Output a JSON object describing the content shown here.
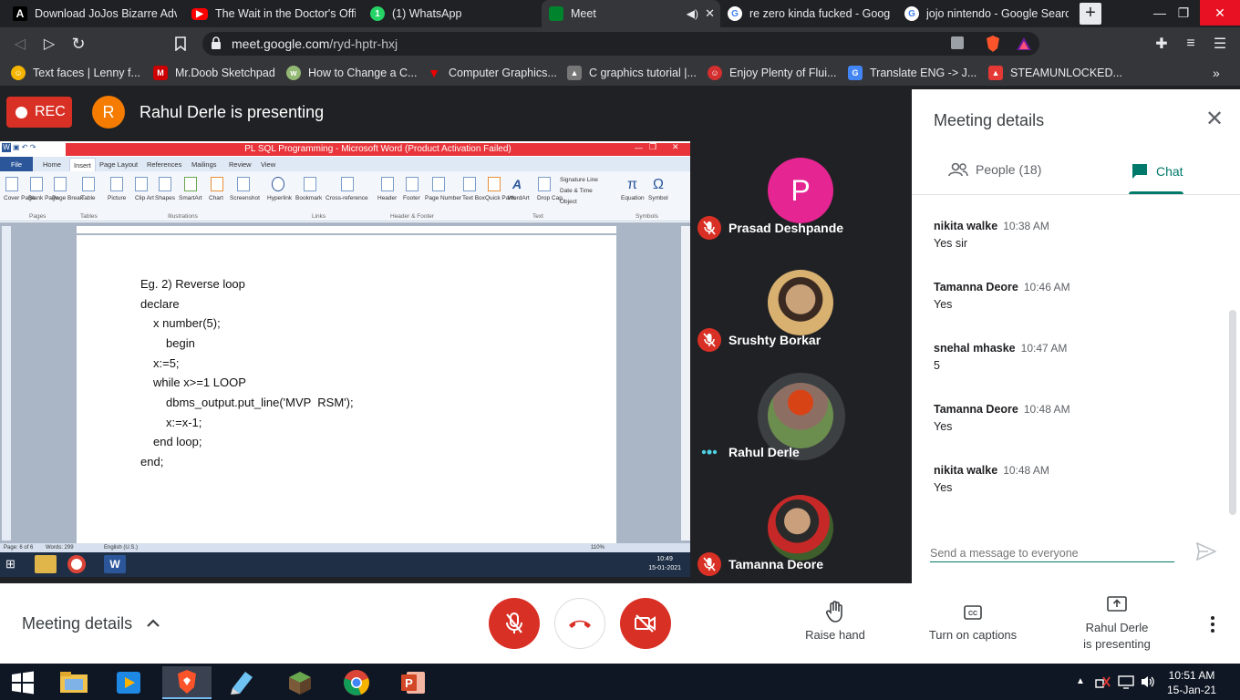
{
  "tabs": [
    {
      "label": "Download JoJos Bizarre Adven",
      "icon": "a-icon"
    },
    {
      "label": "The Wait in the Doctor's Office",
      "icon": "youtube-icon"
    },
    {
      "label": "(1) WhatsApp",
      "icon": "whatsapp-icon"
    },
    {
      "label": "Meet",
      "icon": "meet-icon"
    },
    {
      "label": "re zero kinda fucked - Google",
      "icon": "google-icon"
    },
    {
      "label": "jojo nintendo - Google Search",
      "icon": "google-icon"
    }
  ],
  "url": {
    "host": "meet.google.com",
    "path": "/ryd-hptr-hxj"
  },
  "bookmarks": [
    {
      "label": "Text faces | Lenny f..."
    },
    {
      "label": "Mr.Doob Sketchpad"
    },
    {
      "label": "How to Change a C..."
    },
    {
      "label": "Computer Graphics..."
    },
    {
      "label": "C graphics tutorial |..."
    },
    {
      "label": "Enjoy Plenty of Flui..."
    },
    {
      "label": "Translate ENG -> J..."
    },
    {
      "label": "STEAMUNLOCKED..."
    }
  ],
  "meet": {
    "rec_label": "REC",
    "presenter_initial": "R",
    "presenting_label": "Rahul Derle is presenting"
  },
  "shared_screen": {
    "word_title": "PL SQL Programming - Microsoft Word (Product Activation Failed)",
    "word_tabs": [
      "File",
      "Home",
      "Insert",
      "Page Layout",
      "References",
      "Mailings",
      "Review",
      "View"
    ],
    "ribbon_items": [
      "Cover Page",
      "Blank Page",
      "Page Break",
      "Table",
      "Picture",
      "Clip Art",
      "Shapes",
      "SmartArt",
      "Chart",
      "Screenshot",
      "Hyperlink",
      "Bookmark",
      "Cross-reference",
      "Header",
      "Footer",
      "Page Number",
      "Text Box",
      "Quick Parts",
      "WordArt",
      "Drop Cap",
      "Equation",
      "Symbol"
    ],
    "ribbon_side": [
      "Signature Line",
      "Date & Time",
      "Object"
    ],
    "ribbon_groups": [
      "Pages",
      "Tables",
      "Illustrations",
      "Links",
      "Header & Footer",
      "Text",
      "Symbols"
    ],
    "code_lines": [
      "Eg. 2) Reverse loop",
      "declare",
      "x number(5);",
      "begin",
      "x:=5;",
      "while x>=1 LOOP",
      "dbms_output.put_line('MVP  RSM');",
      "x:=x-1;",
      "end loop;",
      "end;"
    ],
    "status_page": "Page: 6 of 6",
    "status_words": "Words: 299",
    "status_lang": "English (U.S.)",
    "zoom": "110%",
    "inner_time": "10:49",
    "inner_date": "15-01-2021"
  },
  "participants": [
    {
      "name": "Prasad Deshpande",
      "initial": "P",
      "avatar_color": "#e52592",
      "muted": true
    },
    {
      "name": "Srushty Borkar",
      "muted": true
    },
    {
      "name": "Rahul Derle",
      "muted": false
    },
    {
      "name": "Tamanna Deore",
      "muted": true
    }
  ],
  "panel": {
    "title": "Meeting details",
    "people_tab": "People (18)",
    "chat_tab": "Chat",
    "messages": [
      {
        "sender": "nikita walke",
        "time": "10:38 AM",
        "text": "Yes sir"
      },
      {
        "sender": "Tamanna Deore",
        "time": "10:46 AM",
        "text": "Yes"
      },
      {
        "sender": "snehal mhaske",
        "time": "10:47 AM",
        "text": "5"
      },
      {
        "sender": "Tamanna Deore",
        "time": "10:48 AM",
        "text": "Yes"
      },
      {
        "sender": "nikita walke",
        "time": "10:48 AM",
        "text": "Yes"
      }
    ],
    "input_placeholder": "Send a message to everyone"
  },
  "controls": {
    "details_label": "Meeting details",
    "raise_hand": "Raise hand",
    "captions": "Turn on captions",
    "presenting_line1": "Rahul Derle",
    "presenting_line2": "is presenting"
  },
  "taskbar": {
    "time": "10:51 AM",
    "date": "15-Jan-21"
  },
  "colors": {
    "accent_red": "#d93025",
    "chat_accent": "#00796b",
    "meet_bg": "#202124"
  }
}
